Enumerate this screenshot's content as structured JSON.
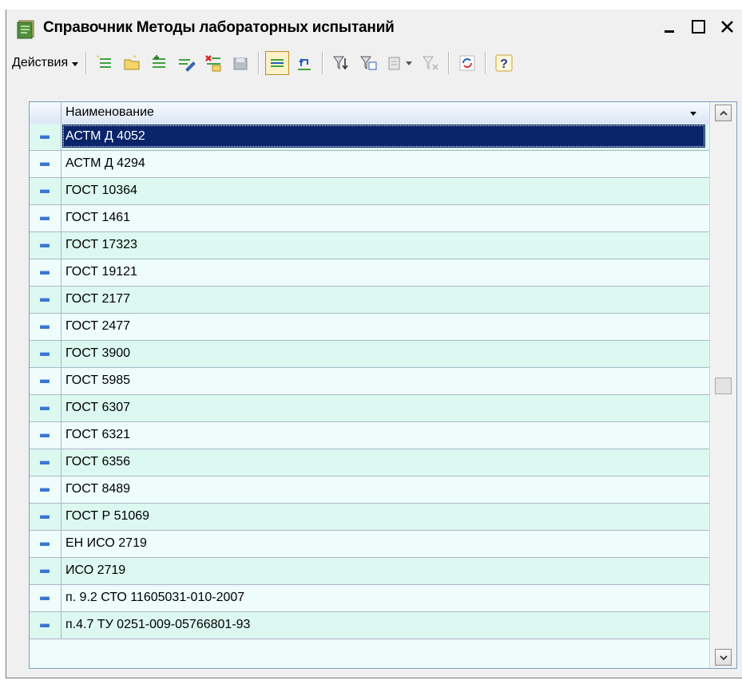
{
  "window": {
    "title": "Справочник Методы лабораторных испытаний"
  },
  "toolbar": {
    "actions_label": "Действия",
    "help_label": "?"
  },
  "grid": {
    "column_header": "Наименование",
    "selected_index": 0,
    "rows": [
      "АСТМ Д 4052",
      "АСТМ Д 4294",
      "ГОСТ 10364",
      "ГОСТ 1461",
      "ГОСТ 17323",
      "ГОСТ 19121",
      "ГОСТ 2177",
      "ГОСТ 2477",
      "ГОСТ 3900",
      "ГОСТ 5985",
      "ГОСТ 6307",
      "ГОСТ 6321",
      "ГОСТ 6356",
      "ГОСТ 8489",
      "ГОСТ Р 51069",
      "ЕН ИСО 2719",
      "ИСО 2719",
      "п. 9.2 СТО 11605031-010-2007",
      "п.4.7 ТУ 0251-009-05766801-93"
    ]
  },
  "colors": {
    "selection": "#0a246a",
    "row_alt": "#dcf8f0",
    "row": "#eefcfc",
    "row_marker": "#3a76d1"
  }
}
